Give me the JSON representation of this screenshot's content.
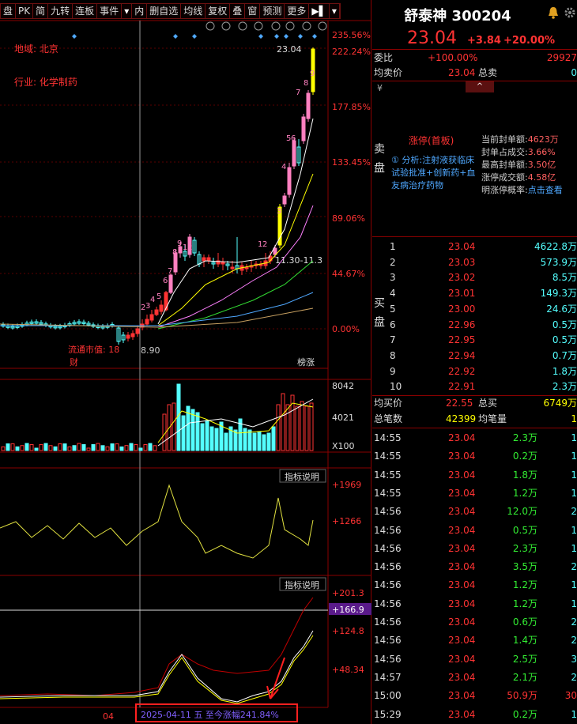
{
  "toolbar": [
    {
      "key": "cut",
      "label": "盘"
    },
    {
      "key": "pk",
      "label": "PK"
    },
    {
      "key": "jian",
      "label": "简"
    },
    {
      "key": "jiuzhuan",
      "label": "九转"
    },
    {
      "key": "lianban",
      "label": "连板"
    },
    {
      "key": "shijian",
      "label": "事件"
    },
    {
      "key": "dropdown",
      "label": "▾"
    },
    {
      "key": "nei",
      "label": "内"
    },
    {
      "key": "shanzixuan",
      "label": "删自选"
    },
    {
      "key": "junxian",
      "label": "均线"
    },
    {
      "key": "fuquan",
      "label": "复权"
    },
    {
      "key": "die",
      "label": "叠"
    },
    {
      "key": "chuang",
      "label": "窗"
    },
    {
      "key": "yuce",
      "label": "预测"
    },
    {
      "key": "gengduo",
      "label": "更多"
    },
    {
      "key": "expand",
      "label": "▶▌"
    },
    {
      "key": "more",
      "label": "▾"
    }
  ],
  "chart": {
    "region_label": "地域: 北京",
    "industry_label": "行业: 化学制药",
    "float_mv_label": "流通市值: 18",
    "low_price_label": "8.90",
    "high_price_label": "23.04",
    "range_label": "11.30-11.3",
    "day_labels": [
      "2",
      "3",
      "4",
      "5",
      "6",
      "7",
      "8",
      "9",
      "12",
      "1",
      "2",
      "3",
      "4",
      "5",
      "6",
      "7",
      "8",
      "9"
    ],
    "marker_cai": "财",
    "marker_bangzhang": "榜涨",
    "pct_labels": [
      "235.56%",
      "222.24%",
      "177.85%",
      "133.45%",
      "89.06%",
      "44.67%",
      "0.00%"
    ],
    "vol_labels": [
      "8042",
      "4021",
      "X100"
    ],
    "ind1_button": "指标说明",
    "ind1_labels": [
      "+1969",
      "+1266"
    ],
    "ind2_button": "指标说明",
    "ind2_labels": [
      "+201.3",
      "+166.9",
      "+124.8",
      "+48.34"
    ],
    "bottom_date": "04",
    "bottom_highlight": "2025-04-11 五  至今涨幅241.84%"
  },
  "quote": {
    "name_code": "舒泰神 300204",
    "price": "23.04",
    "change": "+3.84",
    "change_pct": "+20.00%",
    "weibi_label": "委比",
    "weibi_value": "+100.00%",
    "weibi_right": "29927",
    "junmai_label": "均卖价",
    "junmai_value": "23.04",
    "zongmai_label": "总卖",
    "zongmai_value": "0",
    "sell_side_label": "卖盘",
    "yuan_sign": "¥",
    "limitup_title": "涨停(首板)",
    "analysis": "① 分析:注射液获临床试验批准+创新药+血友病治疗药物",
    "stats": [
      {
        "label": "当前封单额:",
        "value": "4623万"
      },
      {
        "label": "封单占成交:",
        "value": "3.66%"
      },
      {
        "label": "最高封单额:",
        "value": "3.50亿"
      },
      {
        "label": "涨停成交额:",
        "value": "4.58亿"
      },
      {
        "label": "明涨停概率:",
        "value": "点击查看"
      }
    ],
    "buy_side_label": "买盘",
    "buy_levels": [
      {
        "n": "1",
        "p": "23.04",
        "v": "4622.8万"
      },
      {
        "n": "2",
        "p": "23.03",
        "v": "573.9万"
      },
      {
        "n": "3",
        "p": "23.02",
        "v": "8.5万"
      },
      {
        "n": "4",
        "p": "23.01",
        "v": "149.3万"
      },
      {
        "n": "5",
        "p": "23.00",
        "v": "24.6万"
      },
      {
        "n": "6",
        "p": "22.96",
        "v": "0.5万"
      },
      {
        "n": "7",
        "p": "22.95",
        "v": "0.5万"
      },
      {
        "n": "8",
        "p": "22.94",
        "v": "0.7万"
      },
      {
        "n": "9",
        "p": "22.92",
        "v": "1.8万"
      },
      {
        "n": "10",
        "p": "22.91",
        "v": "2.3万"
      }
    ],
    "junmai2_label": "均买价",
    "junmai2_value": "22.55",
    "zongmai2_label": "总买",
    "zongmai2_value": "6749万",
    "bishu_label": "总笔数",
    "bishu_value": "42399",
    "junbi_label": "均笔量",
    "junbi_value": "1",
    "ticks": [
      {
        "t": "14:55",
        "p": "23.04",
        "v": "2.3万",
        "e": "1"
      },
      {
        "t": "14:55",
        "p": "23.04",
        "v": "0.2万",
        "e": "1"
      },
      {
        "t": "14:55",
        "p": "23.04",
        "v": "1.8万",
        "e": "1"
      },
      {
        "t": "14:55",
        "p": "23.04",
        "v": "1.2万",
        "e": "1"
      },
      {
        "t": "14:56",
        "p": "23.04",
        "v": "12.0万",
        "e": "2"
      },
      {
        "t": "14:56",
        "p": "23.04",
        "v": "0.5万",
        "e": "1"
      },
      {
        "t": "14:56",
        "p": "23.04",
        "v": "2.3万",
        "e": "1"
      },
      {
        "t": "14:56",
        "p": "23.04",
        "v": "3.5万",
        "e": "2"
      },
      {
        "t": "14:56",
        "p": "23.04",
        "v": "1.2万",
        "e": "1"
      },
      {
        "t": "14:56",
        "p": "23.04",
        "v": "1.2万",
        "e": "1"
      },
      {
        "t": "14:56",
        "p": "23.04",
        "v": "0.6万",
        "e": "2"
      },
      {
        "t": "14:56",
        "p": "23.04",
        "v": "1.4万",
        "e": "2"
      },
      {
        "t": "14:56",
        "p": "23.04",
        "v": "2.5万",
        "e": "3"
      },
      {
        "t": "14:57",
        "p": "23.04",
        "v": "2.1万",
        "e": "2"
      },
      {
        "t": "15:00",
        "p": "23.04",
        "v": "50.9万",
        "e": "30"
      },
      {
        "t": "15:29",
        "p": "23.04",
        "v": "0.2万",
        "e": "1"
      }
    ]
  },
  "colors": {
    "up": "#ff3333",
    "down": "#54ffff",
    "yellow": "#ffff00",
    "pink": "#ff80c0",
    "bg": "#000000",
    "grid": "#8a0000"
  }
}
